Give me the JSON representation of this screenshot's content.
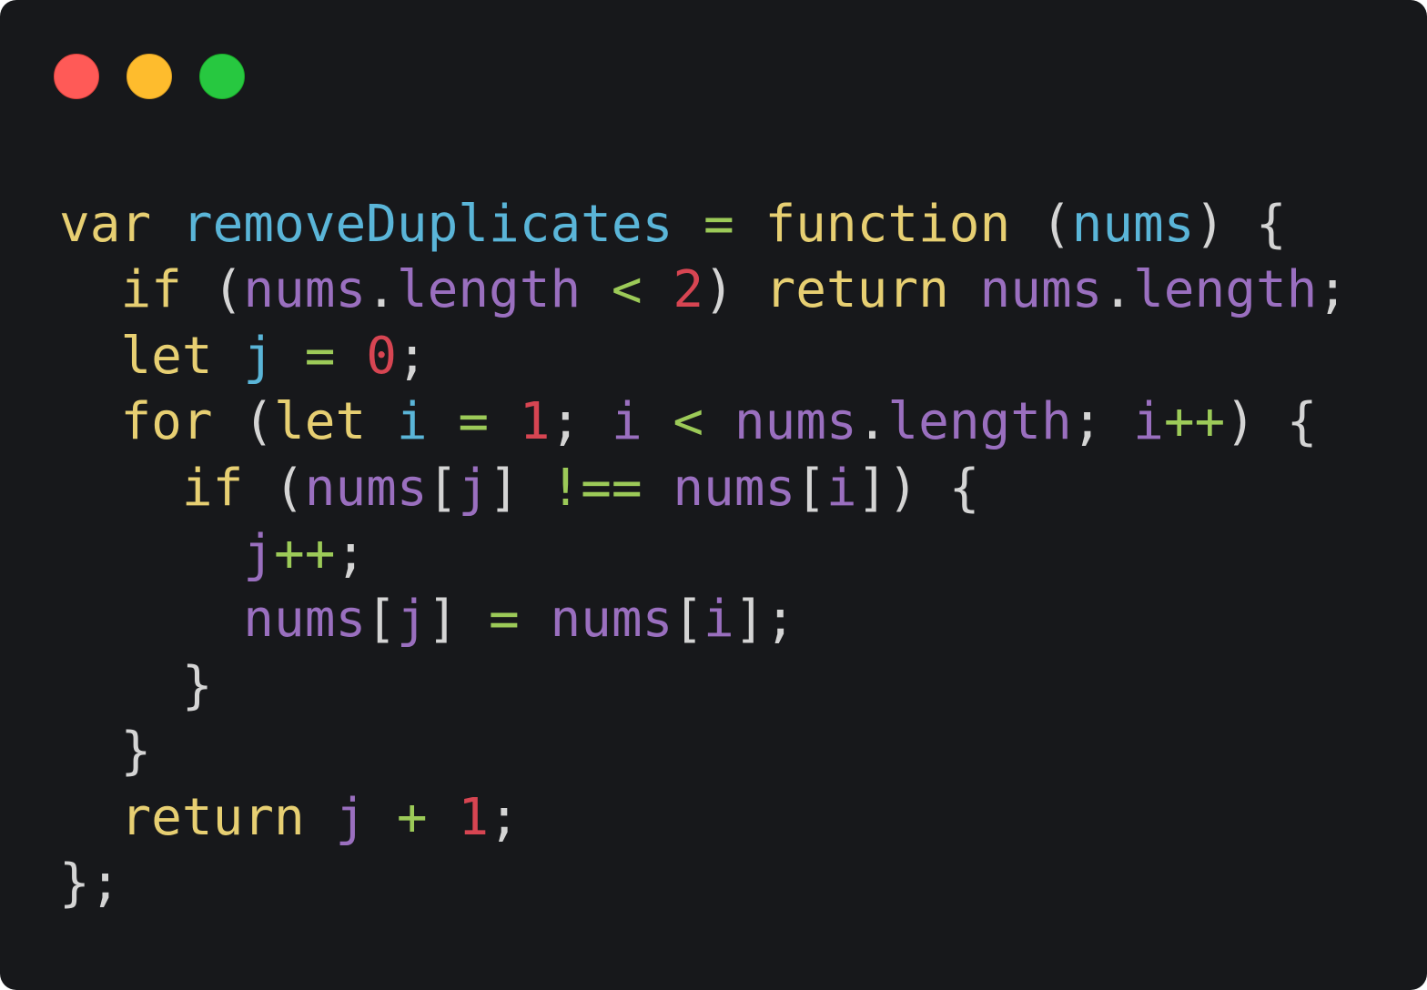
{
  "colors": {
    "background": "#17181b",
    "keyword": "#e7cf72",
    "function_name": "#5ab5d8",
    "variable": "#9a6fbf",
    "operator": "#9cca58",
    "number": "#d74552",
    "punctuation": "#d4d4d4",
    "window_close": "#ff5a57",
    "window_minimize": "#febc2d",
    "window_maximize": "#27c840"
  },
  "window_controls": [
    "close",
    "minimize",
    "maximize"
  ],
  "code_lines": [
    [
      {
        "t": "var",
        "c": "keyword"
      },
      {
        "t": " ",
        "c": "plain"
      },
      {
        "t": "removeDuplicates",
        "c": "fn"
      },
      {
        "t": " ",
        "c": "plain"
      },
      {
        "t": "=",
        "c": "op"
      },
      {
        "t": " ",
        "c": "plain"
      },
      {
        "t": "function",
        "c": "keyword"
      },
      {
        "t": " ",
        "c": "plain"
      },
      {
        "t": "(",
        "c": "punc"
      },
      {
        "t": "nums",
        "c": "param"
      },
      {
        "t": ")",
        "c": "punc"
      },
      {
        "t": " ",
        "c": "plain"
      },
      {
        "t": "{",
        "c": "punc"
      }
    ],
    [
      {
        "t": "  ",
        "c": "plain"
      },
      {
        "t": "if",
        "c": "keyword"
      },
      {
        "t": " ",
        "c": "plain"
      },
      {
        "t": "(",
        "c": "punc"
      },
      {
        "t": "nums",
        "c": "var"
      },
      {
        "t": ".",
        "c": "punc"
      },
      {
        "t": "length",
        "c": "prop"
      },
      {
        "t": " ",
        "c": "plain"
      },
      {
        "t": "<",
        "c": "op"
      },
      {
        "t": " ",
        "c": "plain"
      },
      {
        "t": "2",
        "c": "num"
      },
      {
        "t": ")",
        "c": "punc"
      },
      {
        "t": " ",
        "c": "plain"
      },
      {
        "t": "return",
        "c": "keyword"
      },
      {
        "t": " ",
        "c": "plain"
      },
      {
        "t": "nums",
        "c": "var"
      },
      {
        "t": ".",
        "c": "punc"
      },
      {
        "t": "length",
        "c": "prop"
      },
      {
        "t": ";",
        "c": "punc"
      }
    ],
    [
      {
        "t": "  ",
        "c": "plain"
      },
      {
        "t": "let",
        "c": "keyword"
      },
      {
        "t": " ",
        "c": "plain"
      },
      {
        "t": "j",
        "c": "param"
      },
      {
        "t": " ",
        "c": "plain"
      },
      {
        "t": "=",
        "c": "op"
      },
      {
        "t": " ",
        "c": "plain"
      },
      {
        "t": "0",
        "c": "num"
      },
      {
        "t": ";",
        "c": "punc"
      }
    ],
    [
      {
        "t": "  ",
        "c": "plain"
      },
      {
        "t": "for",
        "c": "keyword"
      },
      {
        "t": " ",
        "c": "plain"
      },
      {
        "t": "(",
        "c": "punc"
      },
      {
        "t": "let",
        "c": "keyword"
      },
      {
        "t": " ",
        "c": "plain"
      },
      {
        "t": "i",
        "c": "param"
      },
      {
        "t": " ",
        "c": "plain"
      },
      {
        "t": "=",
        "c": "op"
      },
      {
        "t": " ",
        "c": "plain"
      },
      {
        "t": "1",
        "c": "num"
      },
      {
        "t": ";",
        "c": "punc"
      },
      {
        "t": " ",
        "c": "plain"
      },
      {
        "t": "i",
        "c": "var"
      },
      {
        "t": " ",
        "c": "plain"
      },
      {
        "t": "<",
        "c": "op"
      },
      {
        "t": " ",
        "c": "plain"
      },
      {
        "t": "nums",
        "c": "var"
      },
      {
        "t": ".",
        "c": "punc"
      },
      {
        "t": "length",
        "c": "prop"
      },
      {
        "t": ";",
        "c": "punc"
      },
      {
        "t": " ",
        "c": "plain"
      },
      {
        "t": "i",
        "c": "var"
      },
      {
        "t": "++",
        "c": "op"
      },
      {
        "t": ")",
        "c": "punc"
      },
      {
        "t": " ",
        "c": "plain"
      },
      {
        "t": "{",
        "c": "punc"
      }
    ],
    [
      {
        "t": "    ",
        "c": "plain"
      },
      {
        "t": "if",
        "c": "keyword"
      },
      {
        "t": " ",
        "c": "plain"
      },
      {
        "t": "(",
        "c": "punc"
      },
      {
        "t": "nums",
        "c": "var"
      },
      {
        "t": "[",
        "c": "punc"
      },
      {
        "t": "j",
        "c": "var"
      },
      {
        "t": "]",
        "c": "punc"
      },
      {
        "t": " ",
        "c": "plain"
      },
      {
        "t": "!==",
        "c": "op"
      },
      {
        "t": " ",
        "c": "plain"
      },
      {
        "t": "nums",
        "c": "var"
      },
      {
        "t": "[",
        "c": "punc"
      },
      {
        "t": "i",
        "c": "var"
      },
      {
        "t": "]",
        "c": "punc"
      },
      {
        "t": ")",
        "c": "punc"
      },
      {
        "t": " ",
        "c": "plain"
      },
      {
        "t": "{",
        "c": "punc"
      }
    ],
    [
      {
        "t": "      ",
        "c": "plain"
      },
      {
        "t": "j",
        "c": "var"
      },
      {
        "t": "++",
        "c": "op"
      },
      {
        "t": ";",
        "c": "punc"
      }
    ],
    [
      {
        "t": "      ",
        "c": "plain"
      },
      {
        "t": "nums",
        "c": "var"
      },
      {
        "t": "[",
        "c": "punc"
      },
      {
        "t": "j",
        "c": "var"
      },
      {
        "t": "]",
        "c": "punc"
      },
      {
        "t": " ",
        "c": "plain"
      },
      {
        "t": "=",
        "c": "op"
      },
      {
        "t": " ",
        "c": "plain"
      },
      {
        "t": "nums",
        "c": "var"
      },
      {
        "t": "[",
        "c": "punc"
      },
      {
        "t": "i",
        "c": "var"
      },
      {
        "t": "]",
        "c": "punc"
      },
      {
        "t": ";",
        "c": "punc"
      }
    ],
    [
      {
        "t": "    ",
        "c": "plain"
      },
      {
        "t": "}",
        "c": "punc"
      }
    ],
    [
      {
        "t": "  ",
        "c": "plain"
      },
      {
        "t": "}",
        "c": "punc"
      }
    ],
    [
      {
        "t": "  ",
        "c": "plain"
      },
      {
        "t": "return",
        "c": "keyword"
      },
      {
        "t": " ",
        "c": "plain"
      },
      {
        "t": "j",
        "c": "var"
      },
      {
        "t": " ",
        "c": "plain"
      },
      {
        "t": "+",
        "c": "op"
      },
      {
        "t": " ",
        "c": "plain"
      },
      {
        "t": "1",
        "c": "num"
      },
      {
        "t": ";",
        "c": "punc"
      }
    ],
    [
      {
        "t": "};",
        "c": "punc"
      }
    ]
  ]
}
